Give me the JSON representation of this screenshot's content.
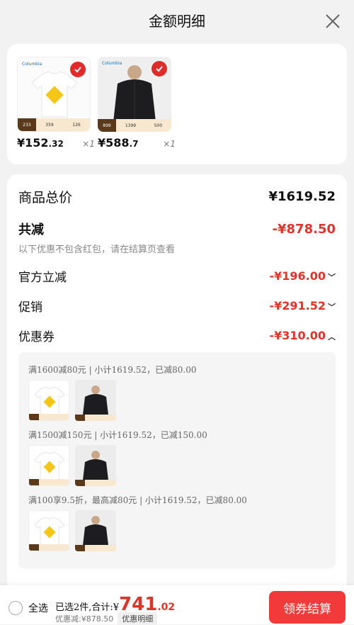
{
  "header": {
    "title": "金额明细"
  },
  "products": [
    {
      "brand": "Columbia",
      "price_int": "¥152",
      "price_dec": ".32",
      "qty": "×1",
      "tag_price": "233",
      "tag_a": "359",
      "tag_b": "126"
    },
    {
      "brand": "Columbia",
      "price_int": "¥588",
      "price_dec": ".7",
      "qty": "×1",
      "tag_price": "899",
      "tag_a": "1399",
      "tag_b": "500"
    }
  ],
  "detail": {
    "total_label": "商品总价",
    "total_value": "¥1619.52",
    "reduce_label": "共减",
    "reduce_value": "-¥878.50",
    "note": "以下优惠不包含红包，请在结算页查看",
    "official_label": "官方立减",
    "official_value": "-¥196.00",
    "promo_label": "促销",
    "promo_value": "-¥291.52",
    "coupon_label": "优惠券",
    "coupon_value": "-¥310.00"
  },
  "coupons": [
    {
      "label": "满1600减80元 | 小计1619.52，已减80.00"
    },
    {
      "label": "满1500减150元 | 小计1619.52，已减150.00"
    },
    {
      "label": "满100享9.5折，最高减80元 | 小计1619.52，已减80.00"
    }
  ],
  "footer": {
    "select_all": "全选",
    "summary_prefix": "已选2件,合计:¥",
    "total_int": "741",
    "total_dec": ".02",
    "discount": "优惠减:¥878.50",
    "detail_btn": "优惠明细",
    "checkout": "领券结算"
  },
  "colors": {
    "accent_red": "#e0342b",
    "checkout_bg": "#f23a3a"
  }
}
